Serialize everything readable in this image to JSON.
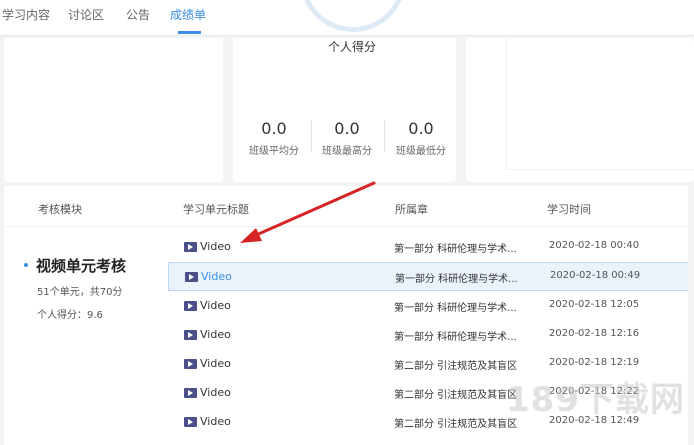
{
  "tabs": [
    {
      "label": "学习内容"
    },
    {
      "label": "讨论区"
    },
    {
      "label": "公告"
    },
    {
      "label": "成绩单"
    }
  ],
  "score": {
    "label": "个人得分"
  },
  "stats": [
    {
      "value": "0.0",
      "label": "班级平均分"
    },
    {
      "value": "0.0",
      "label": "班级最高分"
    },
    {
      "value": "0.0",
      "label": "班级最低分"
    }
  ],
  "table": {
    "headers": {
      "module": "考核模块",
      "unit_title": "学习单元标题",
      "chapter": "所属章",
      "time": "学习时间"
    },
    "module": {
      "title": "视频单元考核",
      "summary": "51个单元，共70分",
      "personal_score": "个人得分：9.6"
    },
    "rows": [
      {
        "title": "Video",
        "chapter": "第一部分 科研伦理与学术...",
        "time": "2020-02-18 00:40"
      },
      {
        "title": "Video",
        "chapter": "第一部分 科研伦理与学术...",
        "time": "2020-02-18 00:49"
      },
      {
        "title": "Video",
        "chapter": "第一部分 科研伦理与学术...",
        "time": "2020-02-18 12:05"
      },
      {
        "title": "Video",
        "chapter": "第一部分 科研伦理与学术...",
        "time": "2020-02-18 12:16"
      },
      {
        "title": "Video",
        "chapter": "第二部分 引注规范及其盲区",
        "time": "2020-02-18 12:19"
      },
      {
        "title": "Video",
        "chapter": "第二部分 引注规范及其盲区",
        "time": "2020-02-18 12:22"
      },
      {
        "title": "Video",
        "chapter": "第二部分 引注规范及其盲区",
        "time": "2020-02-18 12:49"
      }
    ]
  },
  "colors": {
    "accent": "#3a8ee6",
    "arrow": "#d62424",
    "video_icon": "#4b4f8a"
  },
  "watermark": "189下载网"
}
